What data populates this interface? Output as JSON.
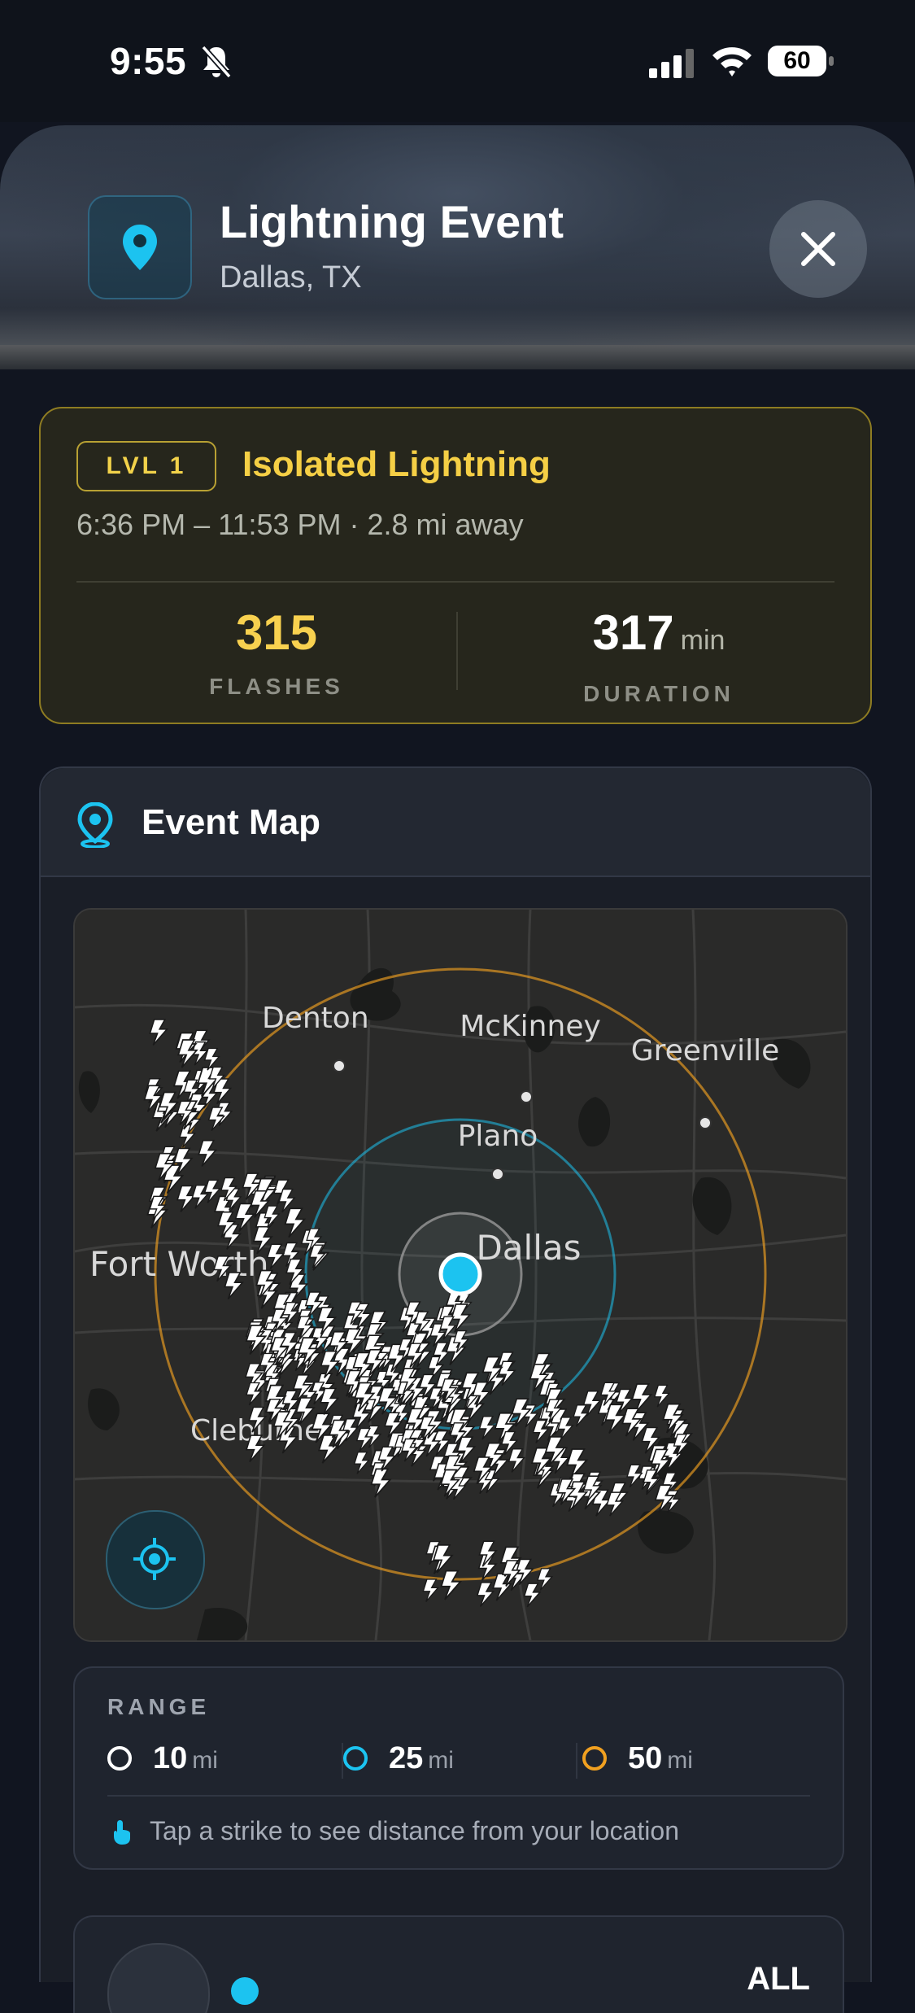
{
  "status_bar": {
    "time": "9:55",
    "battery": "60"
  },
  "header": {
    "title": "Lightning Event",
    "subtitle": "Dallas, TX"
  },
  "event": {
    "level": "LVL 1",
    "type": "Isolated Lightning",
    "time_range": "6:36 PM – 11:53 PM · 2.8 mi away",
    "flashes": {
      "value": "315",
      "label": "FLASHES"
    },
    "duration": {
      "value": "317",
      "unit": "min",
      "label": "DURATION"
    },
    "accent_color": "#f5cf45"
  },
  "map_card": {
    "title": "Event Map",
    "cities": {
      "denton": "Denton",
      "mckinney": "McKinney",
      "greenville": "Greenville",
      "plano": "Plano",
      "dallas": "Dallas",
      "fort_worth": "Fort Worth",
      "cleburne": "Cleburne"
    },
    "strike_count_shown": 315
  },
  "range": {
    "title": "RANGE",
    "items": [
      {
        "value": "10",
        "unit": "mi",
        "color": "#ffffff"
      },
      {
        "value": "25",
        "unit": "mi",
        "color": "#1cc3f0"
      },
      {
        "value": "50",
        "unit": "mi",
        "color": "#f0a020"
      }
    ],
    "hint": "Tap a strike to see distance from your location"
  },
  "next_section": {
    "right_label": "ALL"
  }
}
